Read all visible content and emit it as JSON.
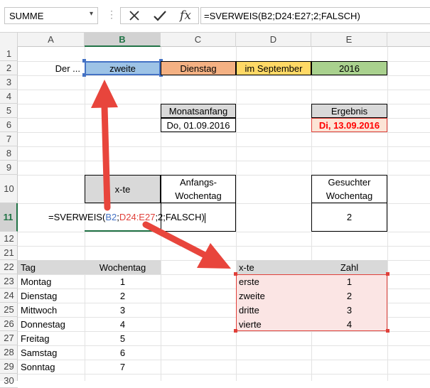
{
  "formula_bar": {
    "name_box": "SUMME",
    "name_box_arrow": "▾",
    "dots": "⋮",
    "cancel_glyph": "✕",
    "confirm_glyph": "✓",
    "fx_glyph": "fx",
    "formula": "=SVERWEIS(B2;D24:E27;2;FALSCH)"
  },
  "columns": [
    "A",
    "B",
    "C",
    "D",
    "E"
  ],
  "rows": [
    "1",
    "2",
    "3",
    "4",
    "5",
    "6",
    "7",
    "8",
    "9",
    "10",
    "11",
    "12",
    "21",
    "22",
    "23",
    "24",
    "25",
    "26",
    "27",
    "28",
    "29",
    "30"
  ],
  "row2": {
    "a": "Der ...",
    "b": "zweite",
    "c": "Dienstag",
    "d": "im September",
    "e": "2016"
  },
  "monatsanfang": {
    "header": "Monatsanfang",
    "value": "Do, 01.09.2016"
  },
  "ergebnis": {
    "header": "Ergebnis",
    "value": "Di, 13.09.2016"
  },
  "xte_block": {
    "header": "x-te",
    "anfangs_header": "Anfangs-\nWochentag",
    "editing_parts": [
      "=SVERWEIS(",
      "B2",
      ";",
      "D24:E27",
      ";2;FALSCH)"
    ]
  },
  "gesuchter": {
    "header": "Gesuchter\nWochentag",
    "value": "2"
  },
  "tag_table": {
    "headers": [
      "Tag",
      "Wochentag"
    ],
    "rows": [
      [
        "Montag",
        "1"
      ],
      [
        "Dienstag",
        "2"
      ],
      [
        "Mittwoch",
        "3"
      ],
      [
        "Donnestag",
        "4"
      ],
      [
        "Freitag",
        "5"
      ],
      [
        "Samstag",
        "6"
      ],
      [
        "Sonntag",
        "7"
      ]
    ]
  },
  "xte_table": {
    "headers": [
      "x-te",
      "Zahl"
    ],
    "rows": [
      [
        "erste",
        "1"
      ],
      [
        "zweite",
        "2"
      ],
      [
        "dritte",
        "3"
      ],
      [
        "vierte",
        "4"
      ]
    ]
  },
  "colors": {
    "blue_cell": "#9dc3e6",
    "orange_cell": "#f4b183",
    "yellow_cell": "#ffd966",
    "green_cell": "#a9d18e",
    "result_bg": "#fce4d6",
    "result_text": "#ff0000",
    "header_gray": "#d9d9d9",
    "ref_blue": "#4472c4",
    "ref_red": "#e0403a",
    "arrow_red": "#e8453c"
  }
}
